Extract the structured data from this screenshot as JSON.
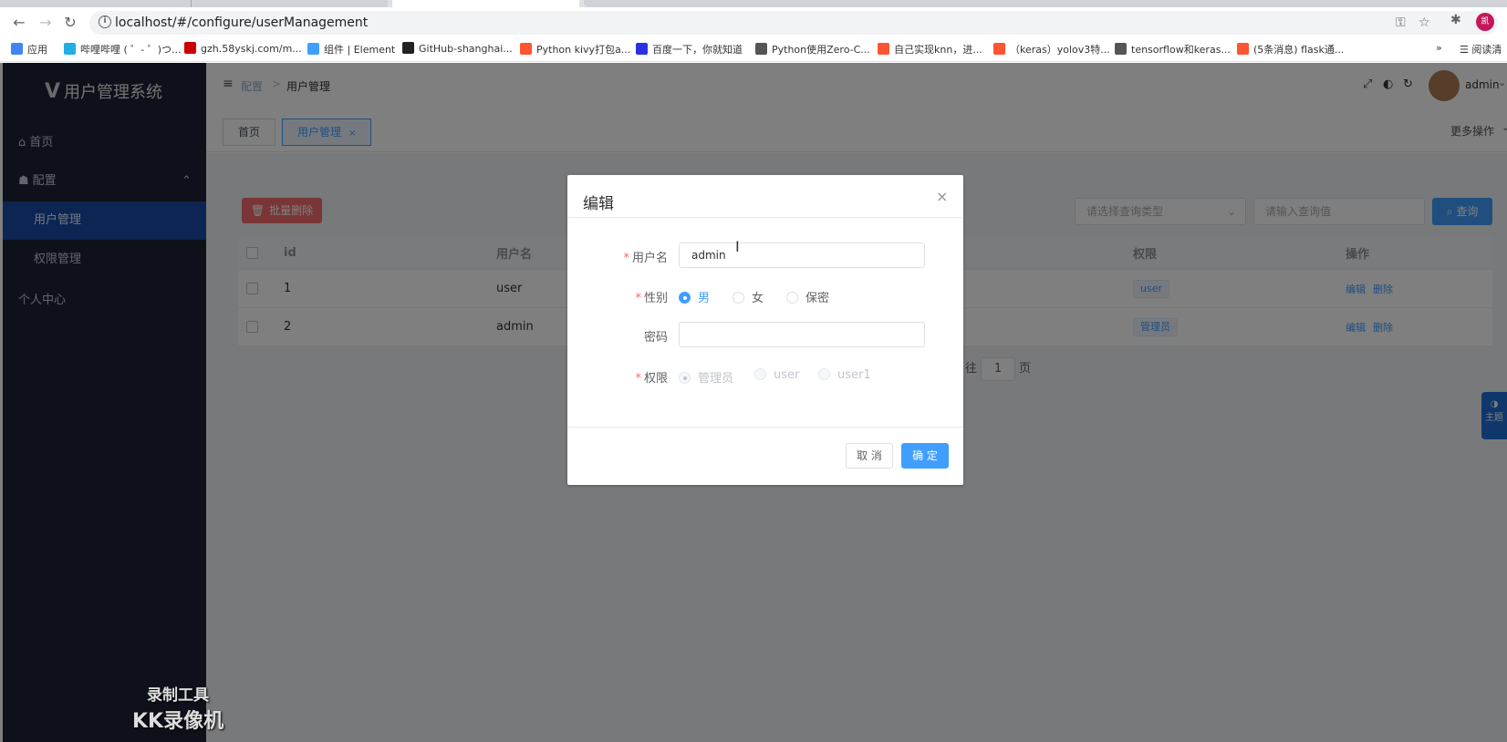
{
  "browser": {
    "url": "localhost/#/configure/userManagement",
    "bookmarks": [
      {
        "label": "应用",
        "color": "#4285f4"
      },
      {
        "label": "哔哩哔哩 ( ゜- ゜)つ...",
        "color": "#23ade5"
      },
      {
        "label": "gzh.58yskj.com/m...",
        "color": "#c00"
      },
      {
        "label": "组件 | Element",
        "color": "#409eff"
      },
      {
        "label": "GitHub-shanghai...",
        "color": "#222"
      },
      {
        "label": "Python kivy打包a...",
        "color": "#fc5531"
      },
      {
        "label": "百度一下，你就知道",
        "color": "#2932e1"
      },
      {
        "label": "Python使用Zero-C...",
        "color": "#555"
      },
      {
        "label": "自己实现knn，进...",
        "color": "#fc5531"
      },
      {
        "label": "（keras）yolov3特...",
        "color": "#fc5531"
      },
      {
        "label": "tensorflow和keras...",
        "color": "#555"
      },
      {
        "label": "(5条消息) flask通...",
        "color": "#fc5531"
      }
    ],
    "more": "»",
    "reading_list": "阅读清"
  },
  "sidebar": {
    "logo": "用户管理系统",
    "items": [
      {
        "label": "首页",
        "icon": "home-icon"
      },
      {
        "label": "配置",
        "icon": "group-icon"
      },
      {
        "label": "用户管理"
      },
      {
        "label": "权限管理"
      },
      {
        "label": "个人中心"
      }
    ]
  },
  "header": {
    "breadcrumb": [
      "配置",
      "用户管理"
    ],
    "user": "admin",
    "more_ops": "更多操作"
  },
  "tags": [
    {
      "label": "首页"
    },
    {
      "label": "用户管理",
      "close": "×"
    }
  ],
  "toolbar": {
    "batch_delete": "批量删除",
    "select_placeholder": "请选择查询类型",
    "input_placeholder": "请输入查询值",
    "search": "查询"
  },
  "table": {
    "headers": [
      "id",
      "用户名",
      "权限",
      "操作"
    ],
    "rows": [
      {
        "id": "1",
        "username": "user",
        "role": "user",
        "edit": "编辑",
        "del": "删除"
      },
      {
        "id": "2",
        "username": "admin",
        "role": "管理员",
        "edit": "编辑",
        "del": "删除"
      }
    ]
  },
  "pager": {
    "prefix": "往",
    "page": "1",
    "suffix": "页"
  },
  "theme_btn": "主题",
  "dialog": {
    "title": "编辑",
    "close": "×",
    "fields": {
      "username_label": "用户名",
      "username_value": "admin",
      "gender_label": "性别",
      "genders": [
        "男",
        "女",
        "保密"
      ],
      "password_label": "密码",
      "password_value": "",
      "role_label": "权限",
      "roles": [
        "管理员",
        "user",
        "user1"
      ]
    },
    "cancel": "取 消",
    "confirm": "确 定"
  },
  "watermark": {
    "line1": "录制工具",
    "line2": "KK录像机"
  },
  "colors": {
    "primary": "#409eff",
    "danger": "#f56c6c",
    "sidebar": "#1c2334",
    "active_menu": "#1b4ba6"
  }
}
